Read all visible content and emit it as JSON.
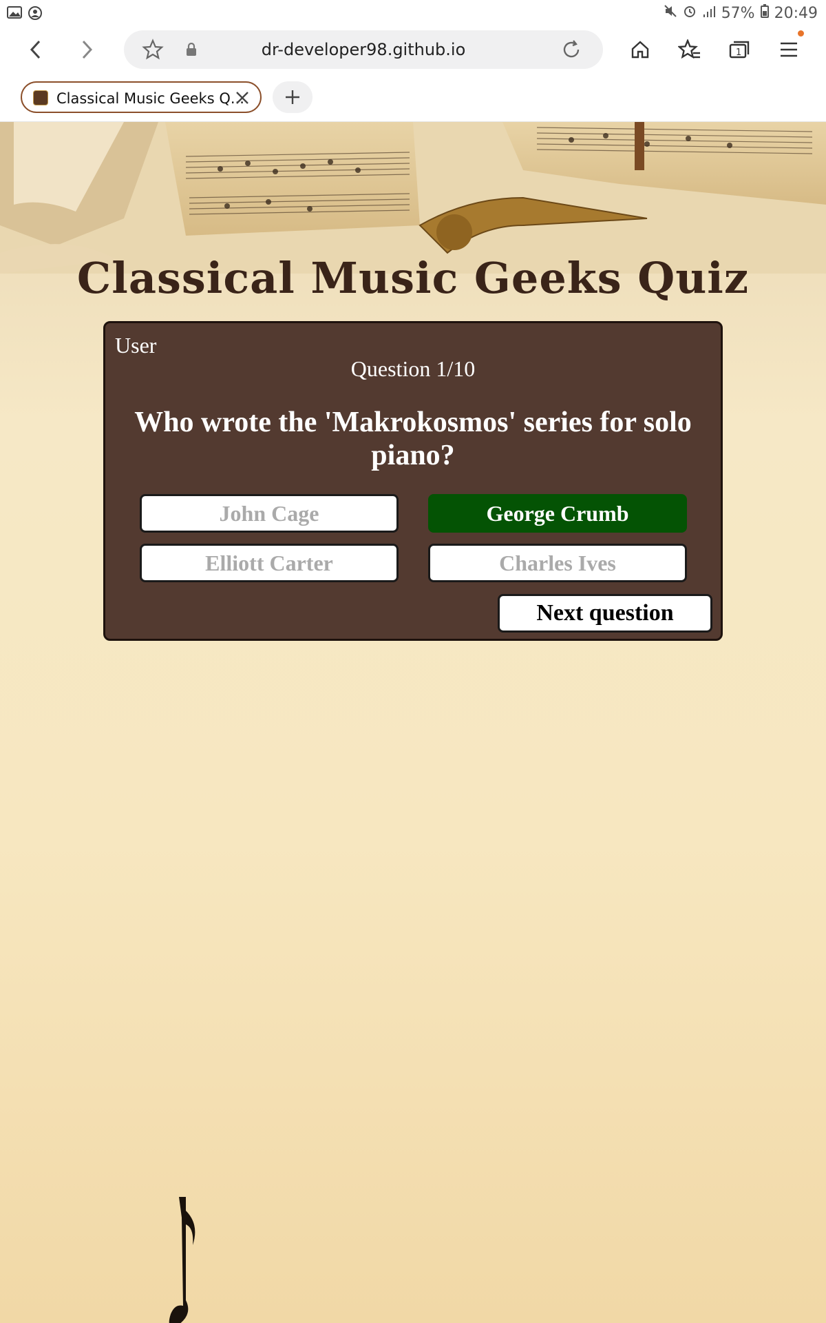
{
  "status_bar": {
    "battery": "57%",
    "time": "20:49",
    "icons": [
      "image-icon",
      "account-icon",
      "mute-icon",
      "alarm-icon",
      "signal-icon",
      "battery-icon"
    ]
  },
  "browser": {
    "url": "dr-developer98.github.io",
    "tab_title": "Classical Music Geeks Q...",
    "icons": [
      "back-icon",
      "forward-icon",
      "bookmark-star-icon",
      "lock-icon",
      "reload-icon",
      "home-icon",
      "bookmarks-icon",
      "tabs-icon",
      "menu-icon",
      "new-tab-icon",
      "tab-close-icon"
    ],
    "tabs_count": "1",
    "accent": "#e8742a"
  },
  "page": {
    "title": "Classical Music Geeks Quiz",
    "user": "User",
    "question_counter": "Question 1/10",
    "question": "Who wrote the 'Makrokosmos' series for solo piano?",
    "answers": [
      {
        "label": "John Cage",
        "state": "disabled"
      },
      {
        "label": "George Crumb",
        "state": "correct"
      },
      {
        "label": "Elliott Carter",
        "state": "disabled"
      },
      {
        "label": "Charles Ives",
        "state": "disabled"
      }
    ],
    "next_label": "Next question",
    "colors": {
      "box": "#533a30",
      "correct": "#045304",
      "title": "#3a2419"
    }
  }
}
